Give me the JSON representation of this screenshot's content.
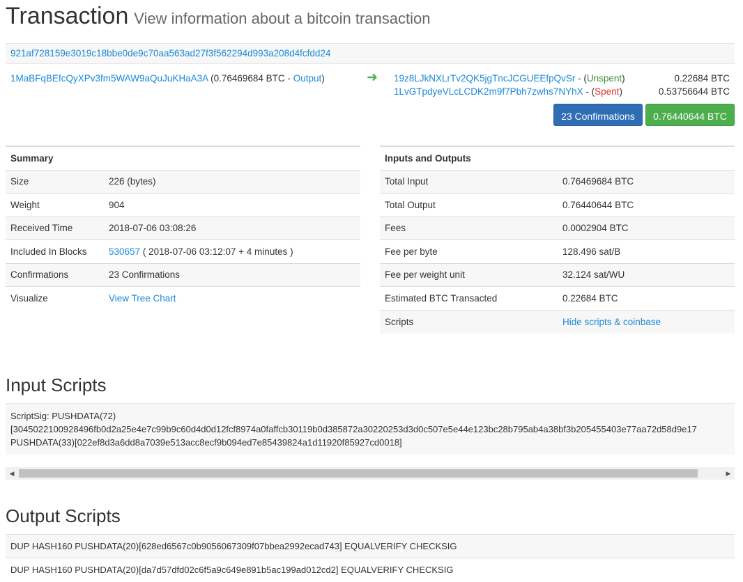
{
  "header": {
    "title": "Transaction",
    "subtitle": "View information about a bitcoin transaction"
  },
  "tx": {
    "hash": "921af728159e3019c18bbe0de9c70aa563ad27f3f562294d993a208d4fcfdd24",
    "input": {
      "address": "1MaBFqBEfcQyXPv3fm5WAW9aQuJuKHaA3A",
      "amount_prefix": " (0.76469684 BTC - ",
      "output_link": "Output",
      "suffix": ")"
    },
    "outputs": [
      {
        "address": "19z8LJkNXLrTv2QK5jgTncJCGUEEfpQvSr",
        "dash": " - (",
        "status": "Unspent",
        "close": ")",
        "amount": "0.22684 BTC"
      },
      {
        "address": "1LvGTpdyeVLcLCDK2m9f7Pbh7zwhs7NYhX",
        "dash": " - (",
        "status": "Spent",
        "close": ")",
        "amount": "0.53756644 BTC"
      }
    ],
    "confirmations_button": "23 Confirmations",
    "total_button": "0.76440644 BTC"
  },
  "summary": {
    "heading": "Summary",
    "rows": [
      {
        "label": "Size",
        "value": "226 (bytes)"
      },
      {
        "label": "Weight",
        "value": "904"
      },
      {
        "label": "Received Time",
        "value": "2018-07-06 03:08:26"
      },
      {
        "label": "Included In Blocks",
        "block_link": "530657",
        "value": " ( 2018-07-06 03:12:07 + 4 minutes )"
      },
      {
        "label": "Confirmations",
        "value": "23 Confirmations"
      },
      {
        "label": "Visualize",
        "link": "View Tree Chart"
      }
    ]
  },
  "inputs_outputs": {
    "heading": "Inputs and Outputs",
    "rows": [
      {
        "label": "Total Input",
        "value": "0.76469684 BTC"
      },
      {
        "label": "Total Output",
        "value": "0.76440644 BTC"
      },
      {
        "label": "Fees",
        "value": "0.0002904 BTC"
      },
      {
        "label": "Fee per byte",
        "value": "128.496 sat/B"
      },
      {
        "label": "Fee per weight unit",
        "value": "32.124 sat/WU"
      },
      {
        "label": "Estimated BTC Transacted",
        "value": "0.22684 BTC"
      },
      {
        "label": "Scripts",
        "link": "Hide scripts & coinbase"
      }
    ]
  },
  "input_scripts": {
    "heading": "Input Scripts",
    "lines": [
      "ScriptSig: PUSHDATA(72)",
      "[3045022100928496fb0d2a25e4e7c99b9c60d4d0d12fcf8974a0faffcb30119b0d385872a30220253d3d0c507e5e44e123bc28b795ab4a38bf3b205455403e77aa72d58d9e17",
      "PUSHDATA(33)[022ef8d3a6dd8a7039e513acc8ecf9b094ed7e85439824a1d11920f85927cd0018]"
    ]
  },
  "output_scripts": {
    "heading": "Output Scripts",
    "lines": [
      "DUP HASH160 PUSHDATA(20)[628ed6567c0b9056067309f07bbea2992ecad743] EQUALVERIFY CHECKSIG",
      "DUP HASH160 PUSHDATA(20)[da7d57dfd02c6f5a9c649e891b5ac199ad012cd2] EQUALVERIFY CHECKSIG"
    ]
  }
}
